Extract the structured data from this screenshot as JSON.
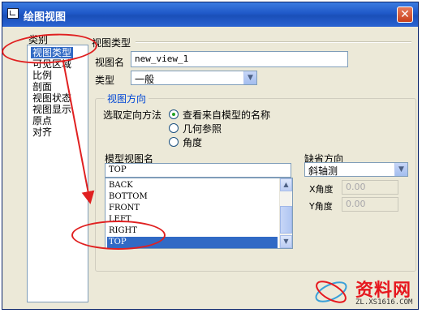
{
  "window": {
    "title": "绘图视图",
    "close_glyph": "✕"
  },
  "categories": {
    "label": "类别",
    "items": [
      "视图类型",
      "可见区域",
      "比例",
      "剖面",
      "视图状态",
      "视图显示",
      "原点",
      "对齐"
    ],
    "selected_index": 0
  },
  "view_type": {
    "group_label": "视图类型",
    "name_label": "视图名",
    "name_value": "new_view_1",
    "type_label": "类型",
    "type_value": "一般"
  },
  "view_orientation": {
    "group_label": "视图方向",
    "method_label": "选取定向方法",
    "options": [
      "查看来自模型的名称",
      "几何参照",
      "角度"
    ],
    "selected_option": 0
  },
  "model_views": {
    "label": "模型视图名",
    "filter_value": "TOP",
    "items": [
      "BACK",
      "BOTTOM",
      "FRONT",
      "LEFT",
      "RIGHT",
      "TOP"
    ],
    "selected_index": 5
  },
  "default_orientation": {
    "label": "缺省方向",
    "value": "斜轴测",
    "x_angle_label": "X角度",
    "x_angle_value": "0.00",
    "y_angle_label": "Y角度",
    "y_angle_value": "0.00"
  },
  "watermark": {
    "text": "资料网",
    "url": "ZL.XS1616.COM"
  },
  "colors": {
    "selection": "#316ac5",
    "annotation": "#e02020",
    "title_bar": "#1f58c8"
  }
}
